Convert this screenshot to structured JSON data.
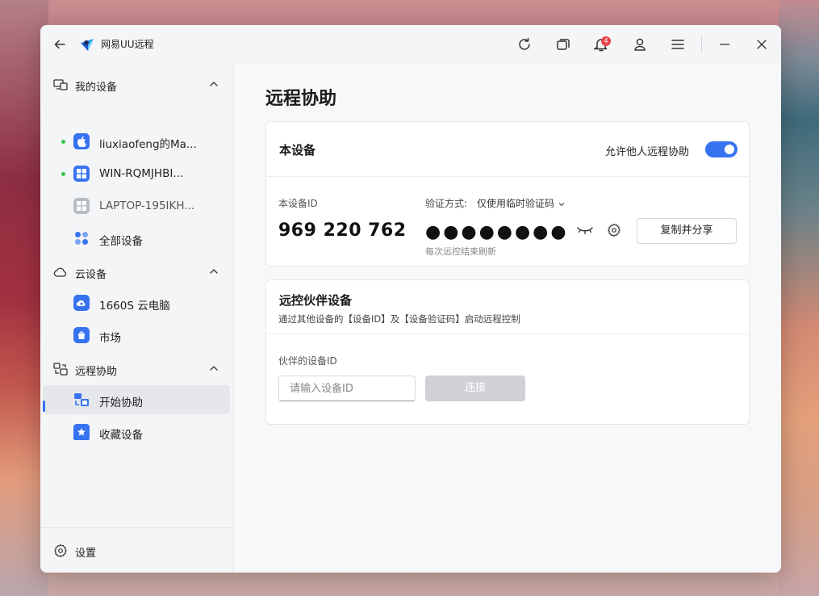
{
  "app": {
    "title": "网易UU远程",
    "notification_count": "4"
  },
  "sidebar": {
    "groups": [
      {
        "label": "我的设备",
        "icon": "devices-icon"
      },
      {
        "label": "云设备",
        "icon": "cloud-icon"
      },
      {
        "label": "远程协助",
        "icon": "remote-assist-icon"
      }
    ],
    "items": [
      {
        "label": "liuxiaofeng的Ma...",
        "online": true,
        "icon": "apple-icon"
      },
      {
        "label": "WIN-RQMJHBI...",
        "online": true,
        "icon": "windows-icon"
      },
      {
        "label": "LAPTOP-195IKH...",
        "online": false,
        "icon": "windows-icon"
      },
      {
        "label": "全部设备",
        "icon": "all-devices-icon"
      },
      {
        "label": "1660S 云电脑",
        "icon": "cloud-pc-icon"
      },
      {
        "label": "市场",
        "icon": "market-icon"
      },
      {
        "label": "开始协助",
        "icon": "start-assist-icon",
        "active": true
      },
      {
        "label": "收藏设备",
        "icon": "favorite-icon"
      }
    ],
    "settings_label": "设置"
  },
  "main": {
    "page_title": "远程协助",
    "this_device": {
      "title": "本设备",
      "allow_label": "允许他人远程协助",
      "allow_enabled": true,
      "id_label": "本设备ID",
      "device_id": "969 220 762",
      "verify_label": "验证方式:",
      "verify_mode": "仅使用临时验证码",
      "password_mask": "●●●●●●●●",
      "refresh_note": "每次远控结束刷新",
      "share_button": "复制并分享"
    },
    "partner": {
      "title": "远控伙伴设备",
      "description": "通过其他设备的【设备ID】及【设备验证码】启动远程控制",
      "id_label": "伙伴的设备ID",
      "input_placeholder": "请输入设备ID",
      "connect_button": "连接"
    }
  },
  "colors": {
    "accent": "#3773f0",
    "online": "#38c34b",
    "badge": "#e8454a"
  }
}
